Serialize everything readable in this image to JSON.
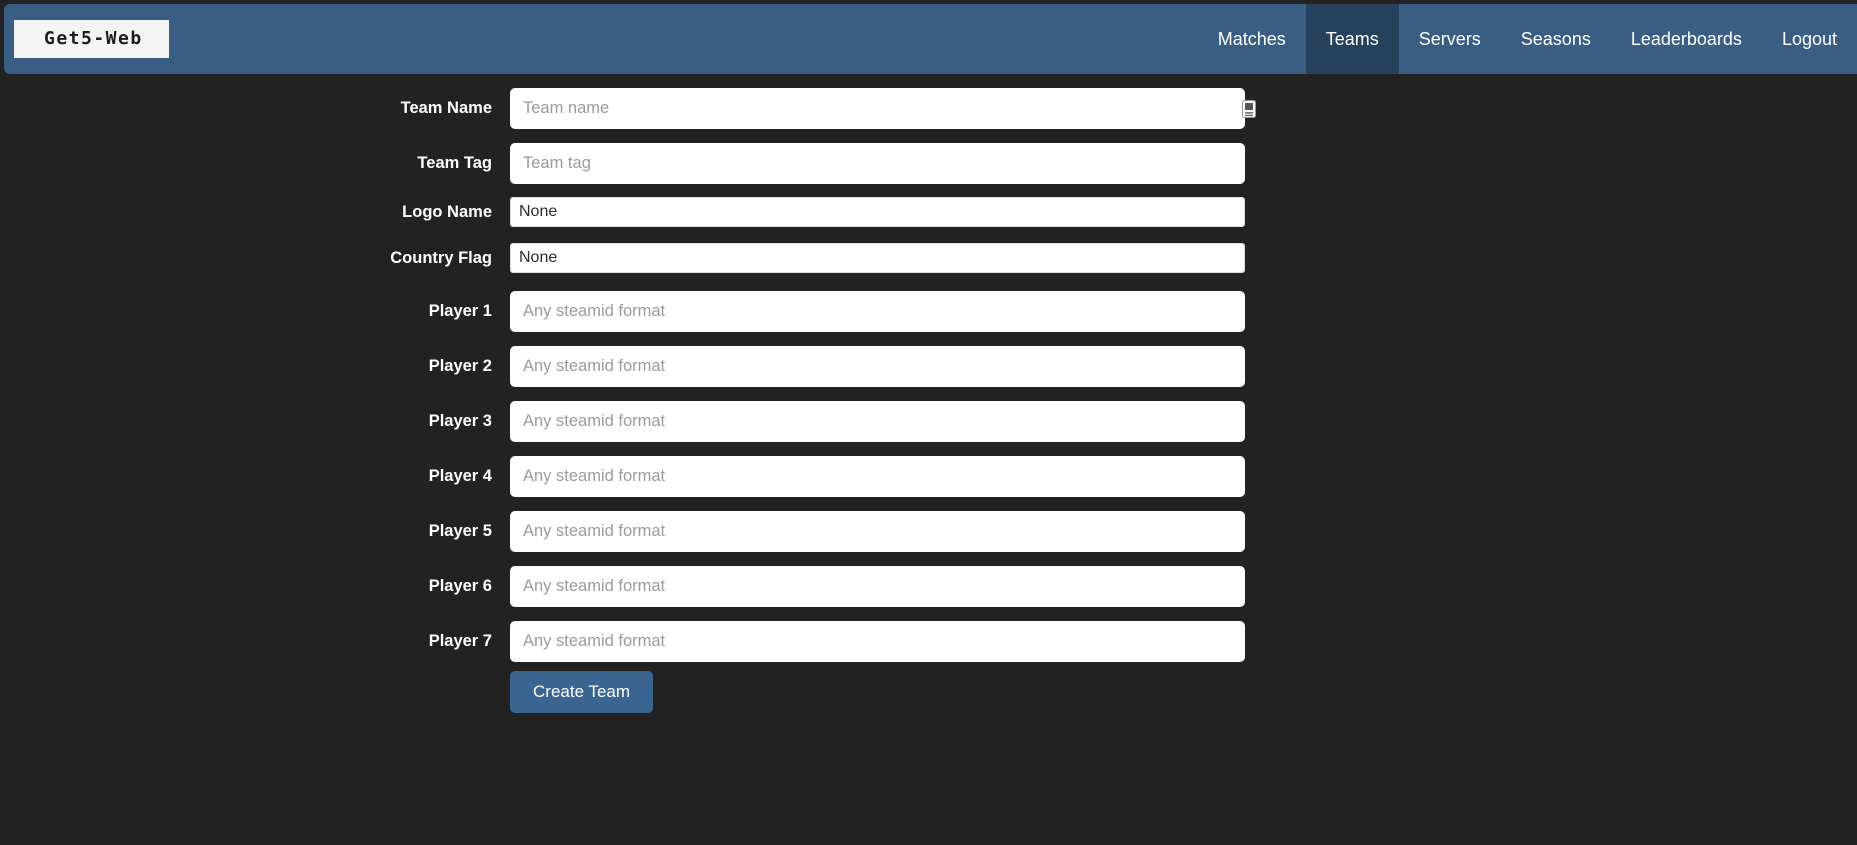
{
  "navbar": {
    "brand": "Get5-Web",
    "links": [
      {
        "label": "Matches",
        "active": false
      },
      {
        "label": "Teams",
        "active": true
      },
      {
        "label": "Servers",
        "active": false
      },
      {
        "label": "Seasons",
        "active": false
      },
      {
        "label": "Leaderboards",
        "active": false
      },
      {
        "label": "Logout",
        "active": false
      }
    ]
  },
  "colors": {
    "navbar_bg": "#3a5d83",
    "navbar_active_bg": "#25415c",
    "page_bg": "#222222",
    "button_bg": "#3a6591",
    "input_bg": "#ffffff",
    "label_color": "#ffffff",
    "placeholder_color": "#9b9b9b"
  },
  "form": {
    "rows": [
      {
        "label": "Team Name",
        "type": "text",
        "value": "",
        "placeholder": "Team name",
        "icon": "autofill-icon"
      },
      {
        "label": "Team Tag",
        "type": "text",
        "value": "",
        "placeholder": "Team tag"
      },
      {
        "label": "Logo Name",
        "type": "select",
        "value": "None"
      },
      {
        "label": "Country Flag",
        "type": "select",
        "value": "None"
      },
      {
        "label": "Player 1",
        "type": "text",
        "value": "",
        "placeholder": "Any steamid format"
      },
      {
        "label": "Player 2",
        "type": "text",
        "value": "",
        "placeholder": "Any steamid format"
      },
      {
        "label": "Player 3",
        "type": "text",
        "value": "",
        "placeholder": "Any steamid format"
      },
      {
        "label": "Player 4",
        "type": "text",
        "value": "",
        "placeholder": "Any steamid format"
      },
      {
        "label": "Player 5",
        "type": "text",
        "value": "",
        "placeholder": "Any steamid format"
      },
      {
        "label": "Player 6",
        "type": "text",
        "value": "",
        "placeholder": "Any steamid format"
      },
      {
        "label": "Player 7",
        "type": "text",
        "value": "",
        "placeholder": "Any steamid format"
      }
    ],
    "submit_label": "Create Team"
  }
}
